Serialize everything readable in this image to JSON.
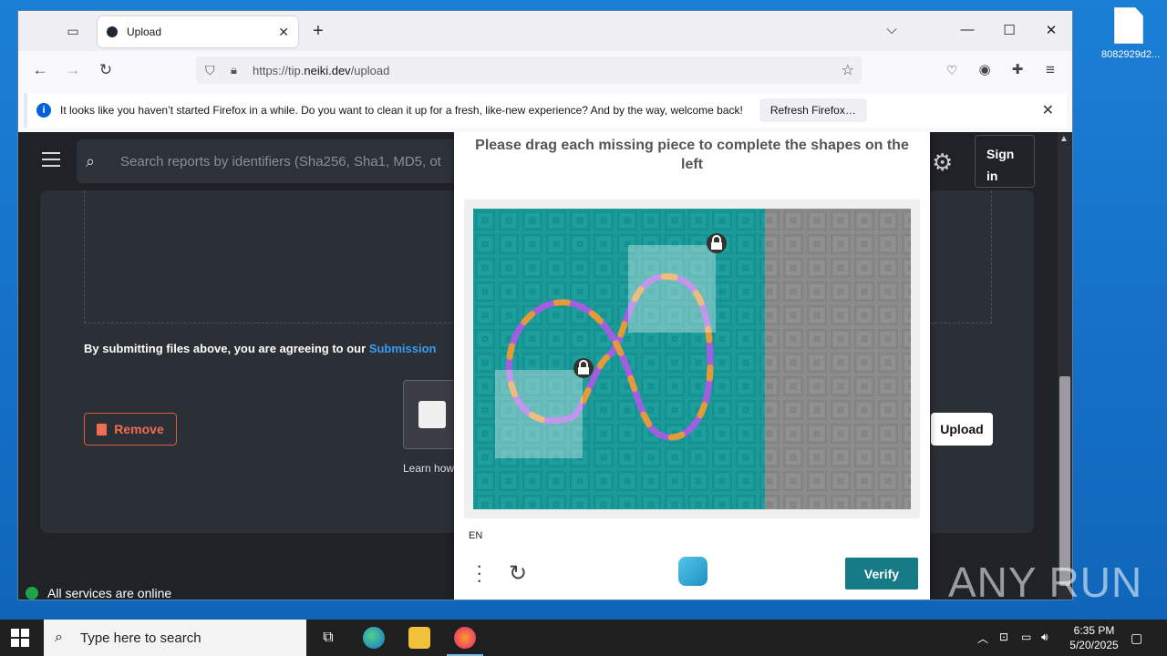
{
  "desktop": {
    "file_label": "8082929d2..."
  },
  "browser": {
    "tab_title": "Upload",
    "url_prefix": "https://tip.",
    "url_domain": "neiki.dev",
    "url_path": "/upload",
    "notification": {
      "message": "It looks like you haven’t started Firefox in a while. Do you want to clean it up for a fresh, like-new experience? And by the way, welcome back!",
      "button": "Refresh Firefox…"
    }
  },
  "site": {
    "search_placeholder": "Search reports by identifiers (Sha256, Sha1, MD5, ot",
    "signin": "Sign in",
    "terms_text": "By submitting files above, you are agreeing to our ",
    "terms_link": "Submission",
    "remove_button": "Remove",
    "learn_text": "Learn how",
    "upload_button": "Upload",
    "status": "All services are online"
  },
  "captcha": {
    "title": "Please drag each missing piece to complete the shapes on the left",
    "language": "EN",
    "verify_button": "Verify",
    "colors": {
      "teal_bg": "#1a9a98",
      "gray_bg": "#8c8c8c",
      "stroke_purple": "#a25ee0",
      "stroke_orange": "#e39a3a",
      "button": "#167b87"
    }
  },
  "taskbar": {
    "search_placeholder": "Type here to search",
    "time": "6:35 PM",
    "date": "5/20/2025"
  },
  "watermark": "ANY RUN"
}
